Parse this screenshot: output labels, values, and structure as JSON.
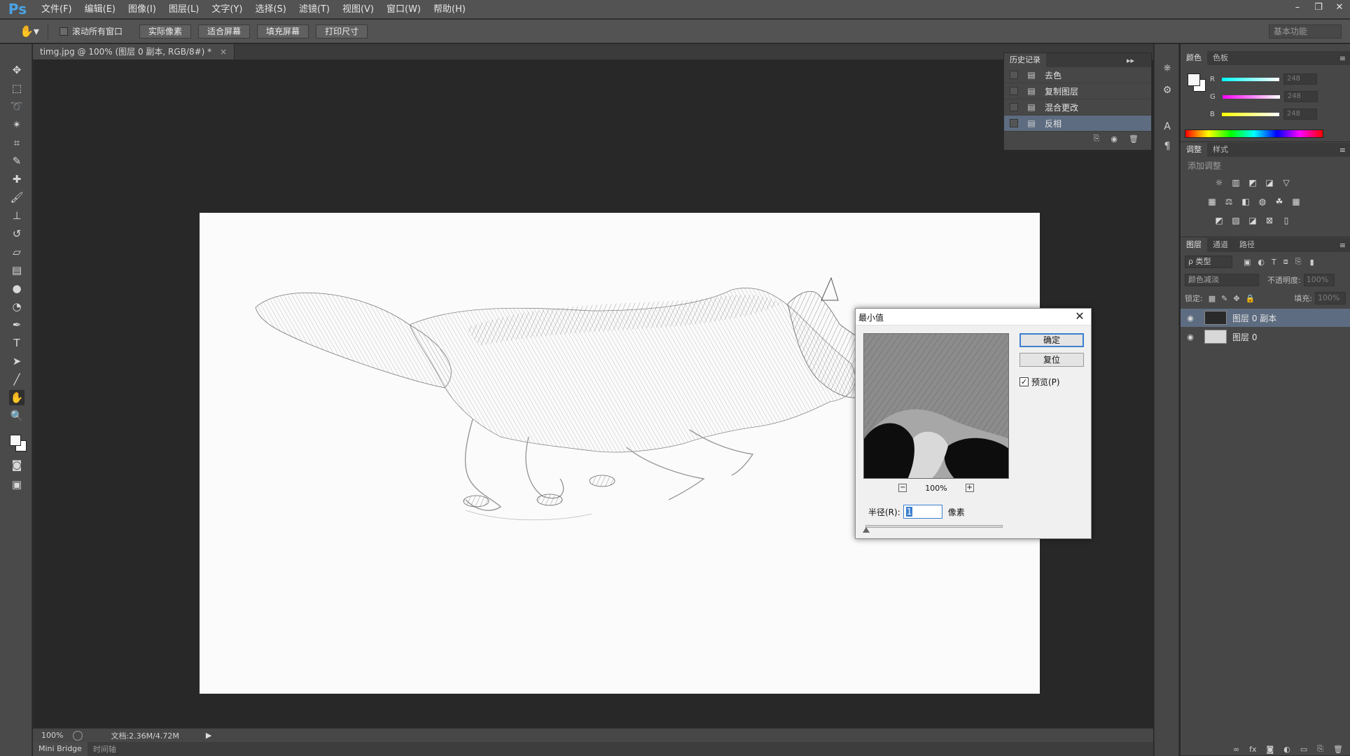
{
  "app": {
    "logo": "Ps",
    "menu": [
      "文件(F)",
      "编辑(E)",
      "图像(I)",
      "图层(L)",
      "文字(Y)",
      "选择(S)",
      "滤镜(T)",
      "视图(V)",
      "窗口(W)",
      "帮助(H)"
    ],
    "window_controls": [
      "–",
      "❐",
      "✕"
    ]
  },
  "options_bar": {
    "scroll_all_label": "滚动所有窗口",
    "buttons": [
      "实际像素",
      "适合屏幕",
      "填充屏幕",
      "打印尺寸"
    ],
    "workspace": "基本功能"
  },
  "document": {
    "tab_title": "timg.jpg @ 100% (图层 0 副本, RGB/8#) *",
    "tab_close": "×"
  },
  "status_bar": {
    "zoom": "100%",
    "doc_size": "文档:2.36M/4.72M",
    "bottom_tabs": [
      "Mini Bridge",
      "时间轴"
    ]
  },
  "history_panel": {
    "tab": "历史记录",
    "items": [
      {
        "label": "去色",
        "selected": false
      },
      {
        "label": "复制图层",
        "selected": false
      },
      {
        "label": "混合更改",
        "selected": false
      },
      {
        "label": "反相",
        "selected": true
      }
    ]
  },
  "color_panel": {
    "tabs": [
      "颜色",
      "色板"
    ],
    "channels": [
      {
        "name": "R",
        "value": "248",
        "color": "#18e0e0"
      },
      {
        "name": "G",
        "value": "248",
        "color": "#e018e0"
      },
      {
        "name": "B",
        "value": "248",
        "color": "#e0e018"
      }
    ]
  },
  "adjustments_panel": {
    "tabs": [
      "调整",
      "样式"
    ],
    "heading": "添加调整"
  },
  "layers_panel": {
    "tabs": [
      "图层",
      "通道",
      "路径"
    ],
    "filter_kind": "ρ 类型",
    "blend_mode": "颜色减淡",
    "opacity_label": "不透明度:",
    "opacity_value": "100%",
    "lock_label": "锁定:",
    "fill_label": "填充:",
    "fill_value": "100%",
    "layers": [
      {
        "name": "图层 0 副本",
        "selected": true
      },
      {
        "name": "图层 0",
        "selected": false
      }
    ]
  },
  "dialog": {
    "title": "最小值",
    "close": "✕",
    "ok": "确定",
    "reset": "复位",
    "preview_label": "预览(P)",
    "preview_checked": true,
    "zoom": "100%",
    "zoom_out": "−",
    "zoom_in": "+",
    "radius_label": "半径(R):",
    "radius_value": "1",
    "radius_unit": "像素"
  },
  "colors": {
    "accent": "#3c7fd0",
    "selection": "#5d6c80",
    "panel_bg": "#474747",
    "canvas_bg": "#282828"
  }
}
